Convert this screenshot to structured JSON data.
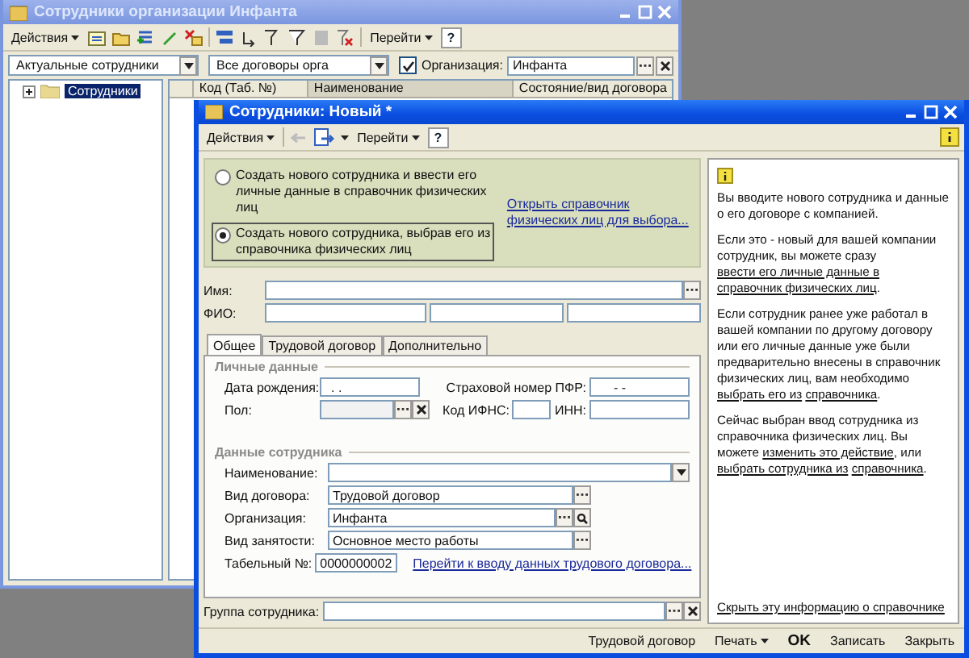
{
  "back_window": {
    "title": "Сотрудники организации Инфанта",
    "toolbar": {
      "actions": "Действия",
      "goto": "Перейти",
      "help": "?"
    },
    "status_filter": {
      "value": "Актуальные сотрудники"
    },
    "contract_filter": {
      "value": "Все договоры орга"
    },
    "organization_filter": {
      "label": "Организация:",
      "checked": true,
      "value": "Инфанта"
    },
    "tree": [
      {
        "label": "Сотрудники",
        "selected": true,
        "expanded": false
      }
    ],
    "columns": [
      "Код (Таб. №)",
      "Наименование",
      "Состояние/вид договора"
    ]
  },
  "form_window": {
    "title": "Сотрудники: Новый *",
    "toolbar": {
      "actions": "Действия",
      "goto": "Перейти",
      "help": "?"
    },
    "mode_options": [
      {
        "label": "Создать нового сотрудника и ввести его личные данные в справочник физических лиц",
        "selected": false
      },
      {
        "label": "Создать нового сотрудника, выбрав его из справочника физических лиц",
        "selected": true
      }
    ],
    "open_link": "Открыть справочник физических лиц для выбора...",
    "name_field": {
      "label": "Имя:"
    },
    "fio_field": {
      "label": "ФИО:"
    },
    "tabs": [
      {
        "label": "Общее",
        "selected": true
      },
      {
        "label": "Трудовой договор",
        "selected": false
      },
      {
        "label": "Дополнительно",
        "selected": false
      }
    ],
    "personal": {
      "title": "Личные данные",
      "birth_date": {
        "label": "Дата рождения:",
        "value": ". ."
      },
      "pfr": {
        "label": "Страховой номер ПФР:",
        "value": "-  -"
      },
      "gender": {
        "label": "Пол:"
      },
      "ifns": {
        "label": "Код ИФНС:"
      },
      "inn": {
        "label": "ИНН:"
      }
    },
    "employee": {
      "title": "Данные сотрудника",
      "fields": [
        {
          "kind": "dropdown",
          "label": "Наименование:"
        },
        {
          "kind": "select",
          "label": "Вид договора:",
          "value": "Трудовой договор"
        },
        {
          "kind": "select_search",
          "label": "Организация:",
          "value": "Инфанта"
        },
        {
          "kind": "select",
          "label": "Вид занятости:",
          "value": "Основное место работы"
        }
      ],
      "tab_number": {
        "label": "Табельный №:",
        "value": "0000000002"
      },
      "contract_link": "Перейти к вводу данных трудового договора..."
    },
    "group_field": {
      "label": "Группа сотрудника:"
    },
    "info_panel": {
      "paragraphs": [
        [
          {
            "text": "Вы вводите нового сотрудника и данные о его договоре с компанией.",
            "kind": "text"
          }
        ],
        [
          {
            "text": "Если это - новый для вашей компании сотрудник, вы можете сразу ",
            "kind": "text"
          },
          {
            "text": "ввести его личные данные в",
            "kind": "link"
          },
          {
            "text": "справочник физических лиц",
            "kind": "link"
          },
          {
            "text": ".",
            "kind": "text"
          }
        ],
        [
          {
            "text": "Если сотрудник ранее уже работал в вашей компании по другому договору или его личные данные уже были предварительно внесены в справочник физических лиц, вам необходимо ",
            "kind": "text"
          },
          {
            "text": "выбрать его из",
            "kind": "link"
          },
          {
            "text": "справочника",
            "kind": "link"
          },
          {
            "text": ".",
            "kind": "text"
          }
        ],
        [
          {
            "text": "Сейчас выбран ввод сотрудника из справочника физических лиц. Вы можете ",
            "kind": "text"
          },
          {
            "text": "изменить это действие",
            "kind": "link"
          },
          {
            "text": ", или ",
            "kind": "text"
          },
          {
            "text": "выбрать сотрудника из",
            "kind": "link"
          },
          {
            "text": "справочника",
            "kind": "link"
          },
          {
            "text": ".",
            "kind": "text"
          }
        ]
      ],
      "hide_link": "Скрыть эту информацию о справочнике"
    },
    "buttons": [
      {
        "label": "Трудовой договор",
        "kind": "plain"
      },
      {
        "label": "Печать",
        "kind": "menu"
      },
      {
        "label": "OK",
        "kind": "default"
      },
      {
        "label": "Записать",
        "kind": "plain"
      },
      {
        "label": "Закрыть",
        "kind": "plain"
      }
    ]
  }
}
